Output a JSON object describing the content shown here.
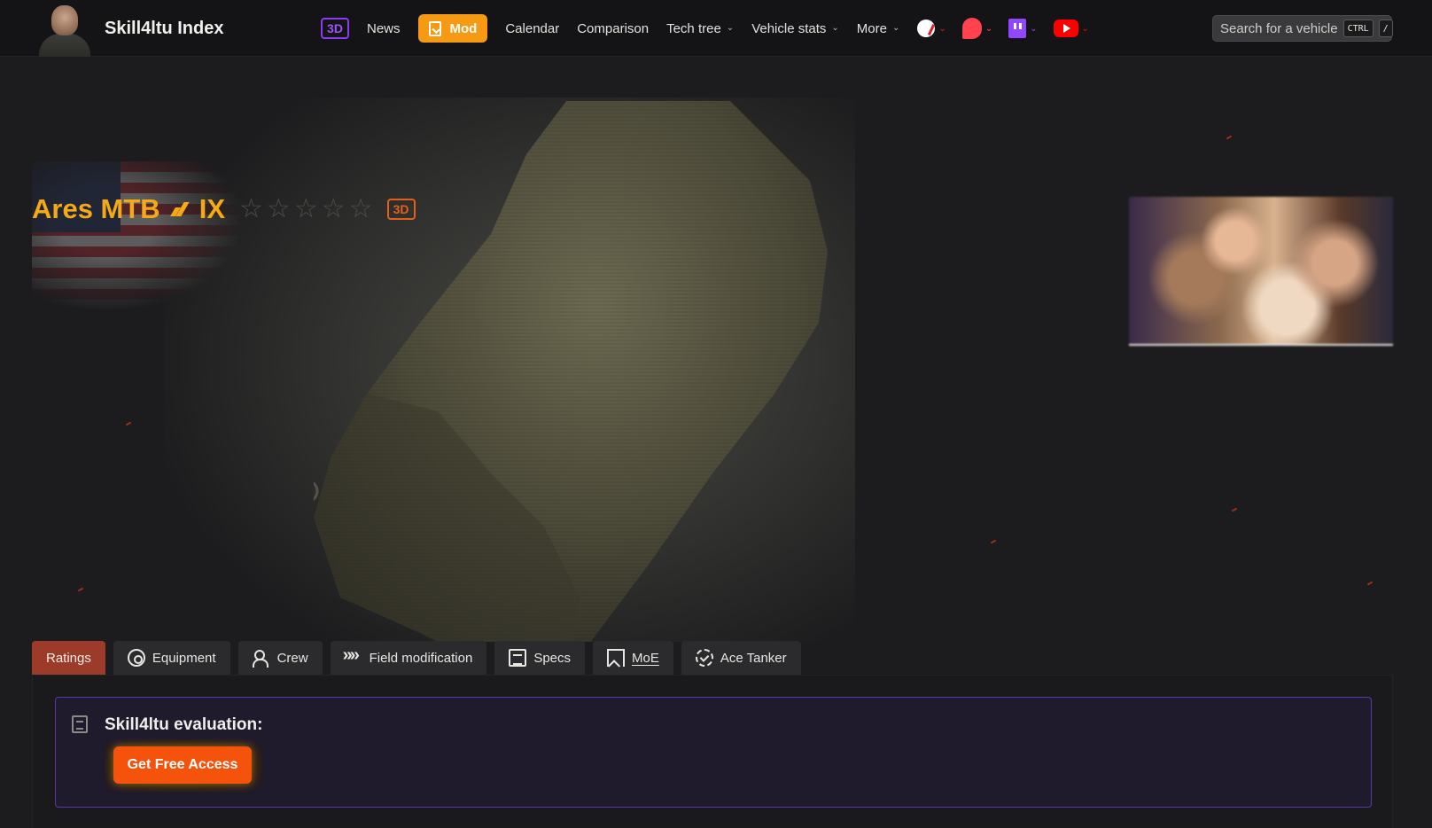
{
  "header": {
    "brand_title": "Skill4ltu Index",
    "nav": {
      "badge_3d": "3D",
      "news": "News",
      "mod": "Mod",
      "calendar": "Calendar",
      "comparison": "Comparison",
      "tech_tree": "Tech tree",
      "vehicle_stats": "Vehicle stats",
      "more": "More"
    },
    "search": {
      "placeholder": "Search for a vehicle",
      "kbd_ctrl": "CTRL",
      "kbd_slash": "/"
    },
    "colors": {
      "mod_accent": "#f59a12",
      "badge_3d": "#8b3cf0"
    }
  },
  "vehicle": {
    "name": "Ares MTB",
    "tier": "IX",
    "class_icon": "medium-tank-icon",
    "rating_stars": 0,
    "rating_max": 5,
    "star_char": "☆",
    "badge_3d": "3D",
    "nation_flag": "usa-flag",
    "accent_color": "#f5a916"
  },
  "tabs": [
    {
      "label": "Ratings",
      "icon": "",
      "active": true
    },
    {
      "label": "Equipment",
      "icon": "gear-icon",
      "active": false
    },
    {
      "label": "Crew",
      "icon": "crew-icon",
      "active": false
    },
    {
      "label": "Field modification",
      "icon": "field-mod-icon",
      "active": false
    },
    {
      "label": "Specs",
      "icon": "specs-icon",
      "active": false
    },
    {
      "label": "MoE",
      "icon": "bookmark-icon",
      "active": false
    },
    {
      "label": "Ace Tanker",
      "icon": "badge-icon",
      "active": false
    }
  ],
  "evaluation": {
    "title": "Skill4ltu evaluation:",
    "cta_label": "Get Free Access",
    "cta_color": "#f5520c",
    "border_color": "#5b36a8"
  }
}
